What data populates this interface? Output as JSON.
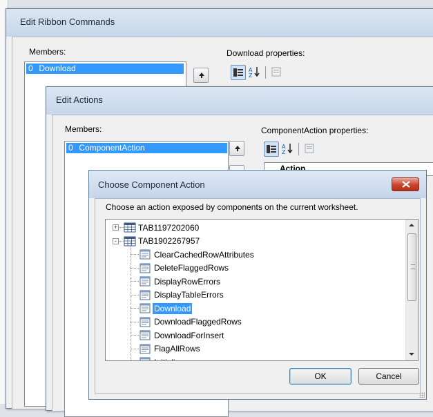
{
  "ribbon_dialog": {
    "title": "Edit Ribbon Commands",
    "members_label": "Members:",
    "properties_label": "Download properties:",
    "selected_member": {
      "index": "0",
      "name": "Download"
    }
  },
  "actions_dialog": {
    "title": "Edit Actions",
    "members_label": "Members:",
    "properties_label": "ComponentAction properties:",
    "selected_member": {
      "index": "0",
      "name": "ComponentAction"
    },
    "grid_partial_text": "Action"
  },
  "choose_dialog": {
    "title": "Choose Component Action",
    "instruction": "Choose an action exposed by components on the current worksheet.",
    "tree": [
      {
        "label": "TAB1197202060",
        "level": 0,
        "expander": "+",
        "icon": "table-icon"
      },
      {
        "label": "TAB1902267957",
        "level": 0,
        "expander": "-",
        "icon": "table-icon"
      },
      {
        "label": "ClearCachedRowAttributes",
        "level": 1,
        "icon": "action-icon"
      },
      {
        "label": "DeleteFlaggedRows",
        "level": 1,
        "icon": "action-icon"
      },
      {
        "label": "DisplayRowErrors",
        "level": 1,
        "icon": "action-icon"
      },
      {
        "label": "DisplayTableErrors",
        "level": 1,
        "icon": "action-icon"
      },
      {
        "label": "Download",
        "level": 1,
        "icon": "action-icon",
        "selected": true
      },
      {
        "label": "DownloadFlaggedRows",
        "level": 1,
        "icon": "action-icon"
      },
      {
        "label": "DownloadForInsert",
        "level": 1,
        "icon": "action-icon"
      },
      {
        "label": "FlagAllRows",
        "level": 1,
        "icon": "action-icon"
      },
      {
        "label": "Initialize",
        "level": 1,
        "icon": "action-icon"
      }
    ],
    "ok_label": "OK",
    "cancel_label": "Cancel"
  },
  "colors": {
    "selection": "#3399ff",
    "close_button": "#c9432c"
  }
}
